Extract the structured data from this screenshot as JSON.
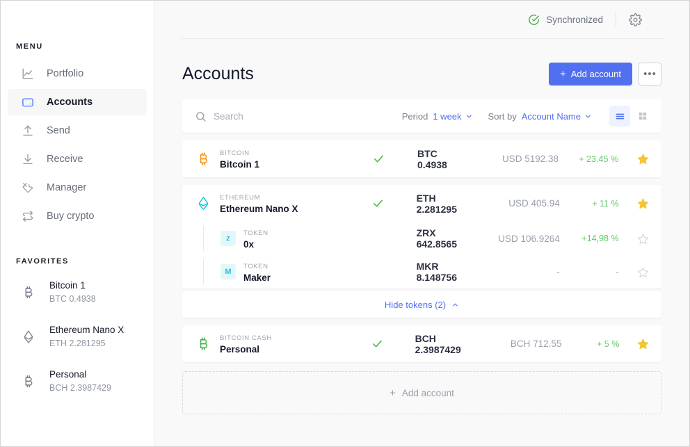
{
  "sidebar": {
    "menu_label": "MENU",
    "favorites_label": "FAVORITES",
    "items": [
      {
        "label": "Portfolio",
        "icon": "chart-line-icon",
        "active": false
      },
      {
        "label": "Accounts",
        "icon": "wallet-icon",
        "active": true
      },
      {
        "label": "Send",
        "icon": "arrow-up-icon",
        "active": false
      },
      {
        "label": "Receive",
        "icon": "arrow-down-icon",
        "active": false
      },
      {
        "label": "Manager",
        "icon": "tools-icon",
        "active": false
      },
      {
        "label": "Buy crypto",
        "icon": "exchange-icon",
        "active": false
      }
    ],
    "favorites": [
      {
        "name": "Bitcoin 1",
        "amount": "BTC 0.4938",
        "icon": "bitcoin-icon"
      },
      {
        "name": "Ethereum Nano X",
        "amount": "ETH 2.281295",
        "icon": "ethereum-icon"
      },
      {
        "name": "Personal",
        "amount": "BCH 2.3987429",
        "icon": "bitcoin-cash-icon"
      }
    ]
  },
  "topbar": {
    "sync_status": "Synchronized",
    "sync_icon": "check-circle-icon",
    "settings_icon": "gear-icon"
  },
  "header": {
    "title": "Accounts",
    "add_account_label": "Add account",
    "add_account_plus": "+",
    "more_label": "•••"
  },
  "filters": {
    "search_placeholder": "Search",
    "search_value": "",
    "search_icon": "search-icon",
    "period_label": "Period",
    "period_value": "1 week",
    "sort_label": "Sort by",
    "sort_value": "Account Name",
    "view_list_icon": "list-view-icon",
    "view_grid_icon": "grid-view-icon",
    "active_view": "list"
  },
  "accounts": [
    {
      "kind": "BITCOIN",
      "name": "Bitcoin 1",
      "icon": "bitcoin-icon",
      "icon_color": "#f7931a",
      "synced": true,
      "amount": "BTC 0.4938",
      "fiat": "USD 5192.38",
      "change": "+ 23.45 %",
      "favorite": true,
      "tokens": []
    },
    {
      "kind": "ETHEREUM",
      "name": "Ethereum Nano X",
      "icon": "ethereum-icon",
      "icon_color": "#00c2d7",
      "synced": true,
      "amount": "ETH 2.281295",
      "fiat": "USD 405.94",
      "change": "+ 11 %",
      "favorite": true,
      "tokens": [
        {
          "kind": "TOKEN",
          "name": "0x",
          "badge": "z",
          "amount": "ZRX 642.8565",
          "fiat": "USD 106.9264",
          "change": "+14,98 %",
          "favorite": false
        },
        {
          "kind": "TOKEN",
          "name": "Maker",
          "badge": "M",
          "amount": "MKR 8.148756",
          "fiat": "-",
          "change": "-",
          "favorite": false
        }
      ],
      "hide_tokens_label": "Hide tokens (2)"
    },
    {
      "kind": "BITCOIN CASH",
      "name": "Personal",
      "icon": "bitcoin-cash-icon",
      "icon_color": "#4caf50",
      "synced": true,
      "amount": "BCH 2.3987429",
      "fiat": "BCH 712.55",
      "change": "+ 5 %",
      "favorite": true,
      "tokens": []
    }
  ],
  "footer": {
    "add_account_label": "Add account",
    "add_account_plus": "+"
  },
  "colors": {
    "accent": "#5070f0",
    "positive": "#5fcb65",
    "star_on": "#f5c433",
    "star_off": "#d5d7dc"
  }
}
